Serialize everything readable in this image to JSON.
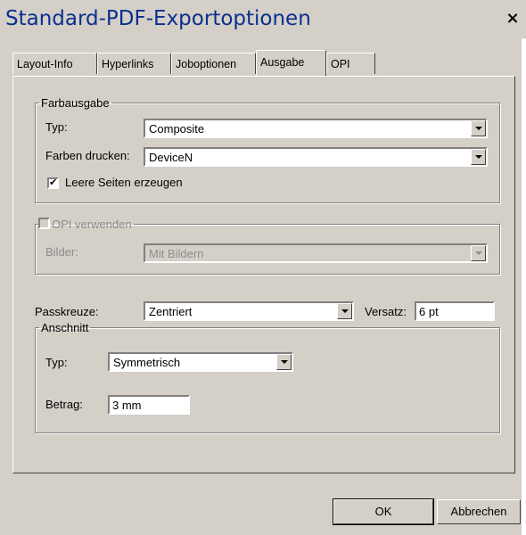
{
  "window": {
    "title": "Standard-PDF-Exportoptionen",
    "close_glyph": "×"
  },
  "tabs": [
    {
      "label": "Layout-Info",
      "active": false
    },
    {
      "label": "Hyperlinks",
      "active": false
    },
    {
      "label": "Joboptionen",
      "active": false
    },
    {
      "label": "Ausgabe",
      "active": true
    },
    {
      "label": "OPI",
      "active": false
    }
  ],
  "farbausgabe": {
    "legend": "Farbausgabe",
    "typ_label": "Typ:",
    "typ_value": "Composite",
    "farben_label": "Farben drucken:",
    "farben_value": "DeviceN",
    "leere_seiten_label": "Leere Seiten erzeugen",
    "leere_seiten_checked": true
  },
  "opi": {
    "checkbox_label": "OPI verwenden",
    "checked": false,
    "enabled": false,
    "bilder_label": "Bilder:",
    "bilder_value": "Mit Bildern"
  },
  "passkreuze": {
    "label": "Passkreuze:",
    "value": "Zentriert",
    "versatz_label": "Versatz:",
    "versatz_value": "6 pt"
  },
  "anschnitt": {
    "legend": "Anschnitt",
    "typ_label": "Typ:",
    "typ_value": "Symmetrisch",
    "betrag_label": "Betrag:",
    "betrag_value": "3 mm"
  },
  "buttons": {
    "ok": "OK",
    "cancel": "Abbrechen"
  },
  "icons": {
    "close": "close-icon",
    "dropdown": "chevron-down-icon",
    "checkbox": "checkbox-icon"
  },
  "colors": {
    "title_text": "#0b2f8f",
    "dialog_bg": "#d4d0c8"
  }
}
